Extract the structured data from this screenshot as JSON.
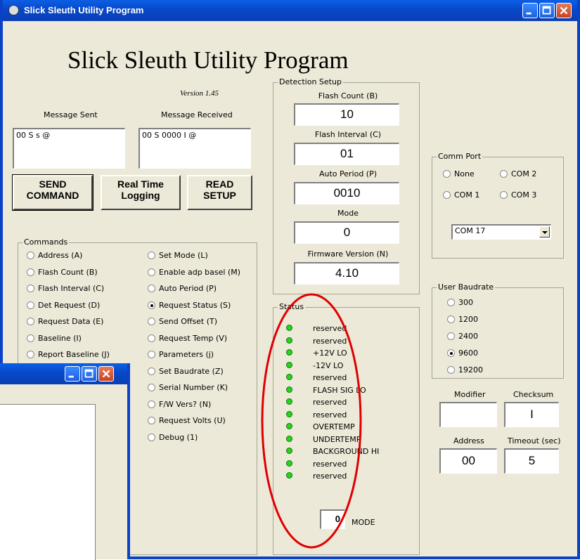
{
  "window": {
    "title": "Slick Sleuth Utility Program"
  },
  "header": {
    "title": "Slick Sleuth Utility Program",
    "version": "Version 1.45"
  },
  "messages": {
    "sent_label": "Message Sent",
    "received_label": "Message Received",
    "sent_value": "00 S s @",
    "received_value": "00 S 0000 I @"
  },
  "buttons": {
    "send": "SEND\nCOMMAND",
    "realtime": "Real Time\nLogging",
    "read": "READ\nSETUP"
  },
  "commands": {
    "title": "Commands",
    "left": [
      {
        "label": "Address (A)",
        "selected": false
      },
      {
        "label": "Flash Count (B)",
        "selected": false
      },
      {
        "label": "Flash Interval (C)",
        "selected": false
      },
      {
        "label": "Det Request (D)",
        "selected": false
      },
      {
        "label": "Request Data (E)",
        "selected": false
      },
      {
        "label": "Baseline (I)",
        "selected": false
      },
      {
        "label": "Report Baseline (J)",
        "selected": false
      }
    ],
    "right": [
      {
        "label": "Set Mode (L)",
        "selected": false
      },
      {
        "label": "Enable adp basel (M)",
        "selected": false
      },
      {
        "label": "Auto Period (P)",
        "selected": false
      },
      {
        "label": "Request Status (S)",
        "selected": true
      },
      {
        "label": "Send Offset (T)",
        "selected": false
      },
      {
        "label": "Request Temp (V)",
        "selected": false
      },
      {
        "label": "Parameters (j)",
        "selected": false
      },
      {
        "label": "Set Baudrate (Z)",
        "selected": false
      },
      {
        "label": "Serial Number (K)",
        "selected": false
      },
      {
        "label": "F/W Vers? (N)",
        "selected": false
      },
      {
        "label": "Request Volts (U)",
        "selected": false
      },
      {
        "label": "Debug (1)",
        "selected": false
      }
    ]
  },
  "detection": {
    "title": "Detection Setup",
    "flash_count_label": "Flash Count (B)",
    "flash_count": "10",
    "flash_interval_label": "Flash Interval (C)",
    "flash_interval": "01",
    "auto_period_label": "Auto Period (P)",
    "auto_period": "0010",
    "mode_label": "Mode",
    "mode": "0",
    "firmware_label": "Firmware Version (N)",
    "firmware": "4.10"
  },
  "status": {
    "title": "Status",
    "items": [
      "reserved",
      "reserved",
      "+12V LO",
      "-12V LO",
      "reserved",
      "FLASH SIG LO",
      "reserved",
      "reserved",
      "OVERTEMP",
      "UNDERTEMP",
      "BACKGROUND HI",
      "reserved",
      "reserved"
    ],
    "led_color": "#28d21e",
    "mode_value": "0",
    "mode_label": "MODE",
    "highlight_color": "#e00000"
  },
  "comm": {
    "title": "Comm Port",
    "options": [
      {
        "label": "None",
        "selected": false
      },
      {
        "label": "COM 2",
        "selected": false
      },
      {
        "label": "COM 1",
        "selected": false
      },
      {
        "label": "COM 3",
        "selected": false
      }
    ],
    "select_value": "COM 17"
  },
  "baud": {
    "title": "User Baudrate",
    "options": [
      {
        "label": "300",
        "selected": false
      },
      {
        "label": "1200",
        "selected": false
      },
      {
        "label": "2400",
        "selected": false
      },
      {
        "label": "9600",
        "selected": true
      },
      {
        "label": "19200",
        "selected": false
      }
    ]
  },
  "fields": {
    "modifier_label": "Modifier",
    "modifier": "",
    "checksum_label": "Checksum",
    "checksum": "I",
    "address_label": "Address",
    "address": "00",
    "timeout_label": "Timeout (sec)",
    "timeout": "5"
  },
  "colors": {
    "titlebar": "#0a41c8",
    "face": "#ece9d8"
  }
}
